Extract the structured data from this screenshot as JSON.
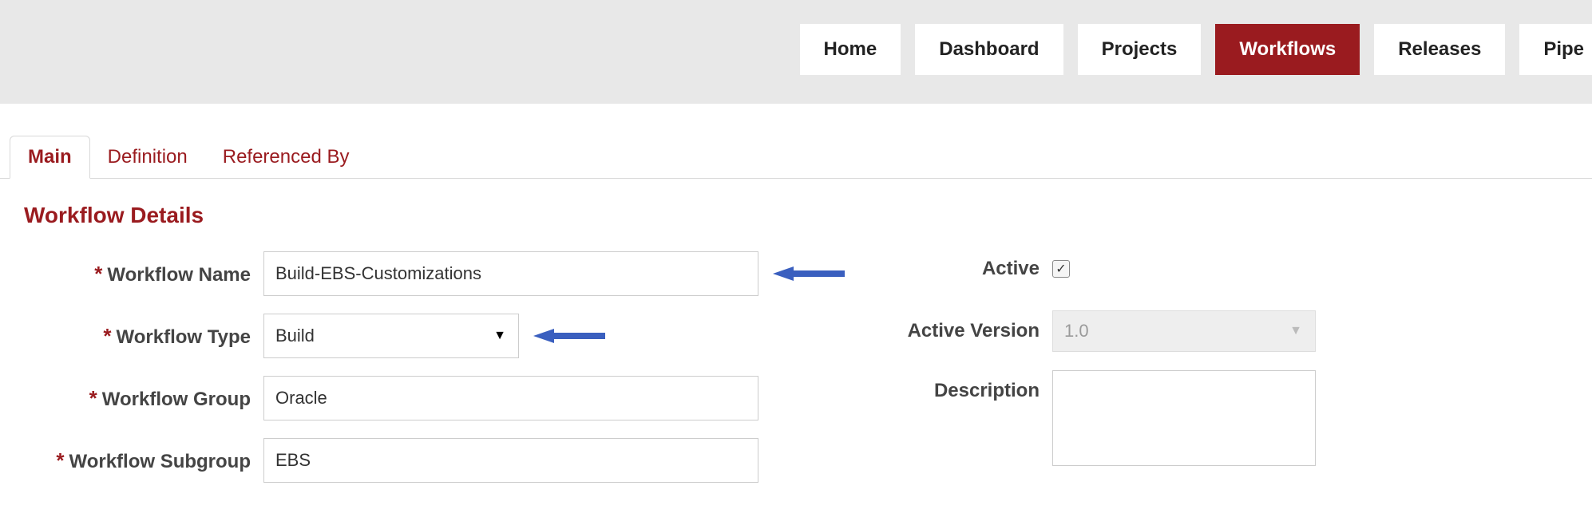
{
  "nav": {
    "items": [
      {
        "label": "Home",
        "active": false
      },
      {
        "label": "Dashboard",
        "active": false
      },
      {
        "label": "Projects",
        "active": false
      },
      {
        "label": "Workflows",
        "active": true
      },
      {
        "label": "Releases",
        "active": false
      },
      {
        "label": "Pipe",
        "active": false
      }
    ]
  },
  "tabs": {
    "items": [
      {
        "label": "Main",
        "active": true
      },
      {
        "label": "Definition",
        "active": false
      },
      {
        "label": "Referenced By",
        "active": false
      }
    ]
  },
  "section": {
    "title": "Workflow Details"
  },
  "form": {
    "required_mark": "*",
    "workflow_name": {
      "label": "Workflow Name",
      "value": "Build-EBS-Customizations"
    },
    "workflow_type": {
      "label": "Workflow Type",
      "value": "Build"
    },
    "workflow_group": {
      "label": "Workflow Group",
      "value": "Oracle"
    },
    "workflow_subgroup": {
      "label": "Workflow Subgroup",
      "value": "EBS"
    },
    "active": {
      "label": "Active",
      "checked": true,
      "mark": "✓"
    },
    "active_version": {
      "label": "Active Version",
      "value": "1.0"
    },
    "description": {
      "label": "Description",
      "value": ""
    }
  },
  "glyphs": {
    "caret_down": "▼"
  }
}
